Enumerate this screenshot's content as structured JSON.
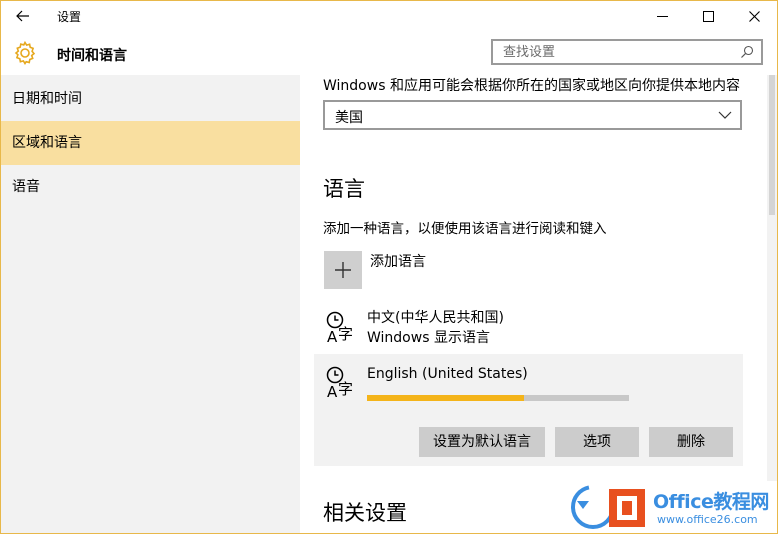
{
  "window": {
    "title": "设置"
  },
  "header": {
    "app_title": "时间和语言",
    "search_placeholder": "查找设置"
  },
  "sidebar": {
    "items": [
      {
        "label": "日期和时间",
        "active": false
      },
      {
        "label": "区域和语言",
        "active": true
      },
      {
        "label": "语音",
        "active": false
      }
    ]
  },
  "region": {
    "description": "Windows 和应用可能会根据你所在的国家或地区向你提供本地内容",
    "country_value": "美国"
  },
  "language": {
    "title": "语言",
    "description": "添加一种语言，以便使用该语言进行阅读和键入",
    "add_label": "添加语言",
    "items": [
      {
        "name": "中文(中华人民共和国)",
        "sub": "Windows 显示语言"
      },
      {
        "name": "English (United States)",
        "progress": 0.6
      }
    ],
    "buttons": {
      "set_default": "设置为默认语言",
      "options": "选项",
      "remove": "删除"
    }
  },
  "related": {
    "title": "相关设置"
  },
  "watermark": {
    "brand": "Office教程网",
    "url": "www.office26.com"
  },
  "colors": {
    "accent": "#f9dfa0",
    "progress": "#f4b41a",
    "border": "#e8b84a",
    "watermark_blue": "#3a8ee0",
    "watermark_orange": "#e8501f"
  }
}
